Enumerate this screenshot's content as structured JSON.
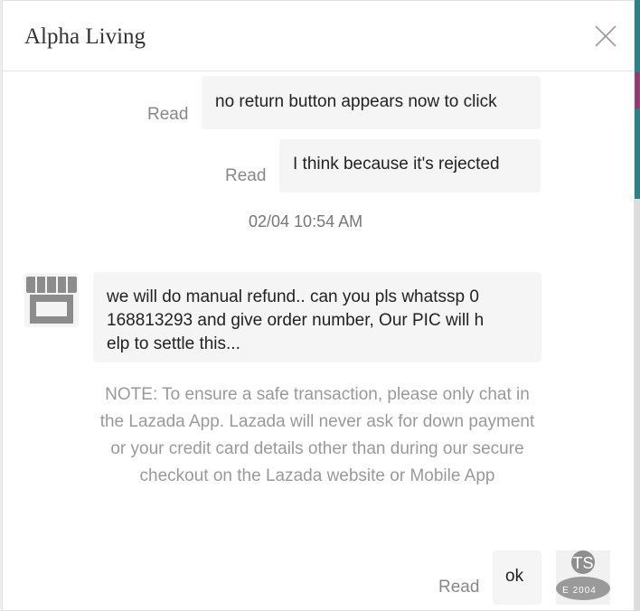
{
  "header": {
    "title": "Alpha Living",
    "close_icon": "close-icon"
  },
  "messages": [
    {
      "direction": "outgoing",
      "text": "no return button appears now to click",
      "status": "Read"
    },
    {
      "direction": "outgoing",
      "text": "I think because it's rejected",
      "status": "Read"
    }
  ],
  "timestamp": "02/04 10:54 AM",
  "incoming": {
    "avatar_icon": "shop-icon",
    "line1": "we will do manual refund.. can you pls whatssp 0",
    "line2": "168813293 and give order number, Our PIC will h",
    "line3": "elp to settle this..."
  },
  "note": "NOTE: To ensure a safe transaction, please only chat in the Lazada App. Lazada will never ask for down payment or your credit card details other than during our secure checkout on the Lazada website or Mobile App",
  "last_message": {
    "direction": "outgoing",
    "text": "ok",
    "status": "Read"
  },
  "thumbnail": {
    "line1": "TS",
    "line2": "E 2004"
  }
}
